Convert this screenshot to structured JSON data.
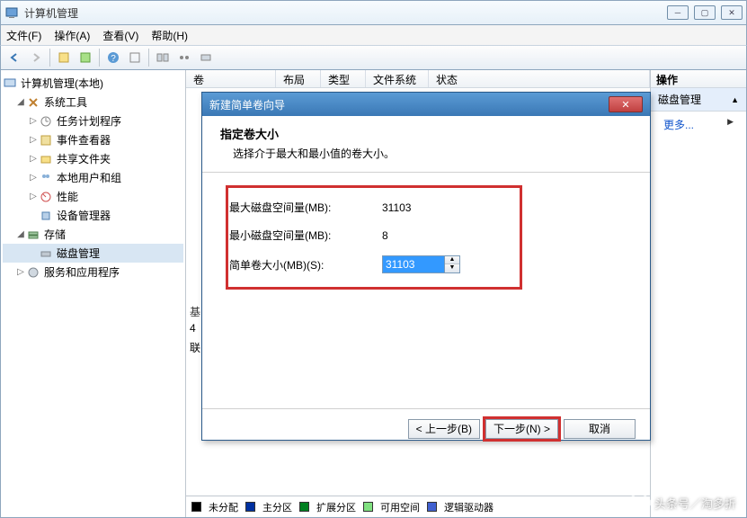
{
  "window": {
    "title": "计算机管理"
  },
  "menu": {
    "file": "文件(F)",
    "action": "操作(A)",
    "view": "查看(V)",
    "help": "帮助(H)"
  },
  "tree": {
    "root": "计算机管理(本地)",
    "system_tools": "系统工具",
    "task_scheduler": "任务计划程序",
    "event_viewer": "事件查看器",
    "shared_folders": "共享文件夹",
    "local_users": "本地用户和组",
    "performance": "性能",
    "device_manager": "设备管理器",
    "storage": "存储",
    "disk_management": "磁盘管理",
    "services_apps": "服务和应用程序"
  },
  "columns": {
    "volume": "卷",
    "layout": "布局",
    "type": "类型",
    "filesystem": "文件系统",
    "status": "状态"
  },
  "peek": {
    "l1": "基",
    "l2": "4",
    "l3": "联"
  },
  "right": {
    "header": "操作",
    "disk_mgmt": "磁盘管理",
    "more": "更多..."
  },
  "legend": {
    "unallocated": "未分配",
    "primary": "主分区",
    "extended": "扩展分区",
    "free": "可用空间",
    "logical": "逻辑驱动器"
  },
  "wizard": {
    "title": "新建简单卷向导",
    "heading": "指定卷大小",
    "subheading": "选择介于最大和最小值的卷大小。",
    "max_label": "最大磁盘空间量(MB):",
    "max_value": "31103",
    "min_label": "最小磁盘空间量(MB):",
    "min_value": "8",
    "size_label": "简单卷大小(MB)(S):",
    "size_value": "31103",
    "back": "< 上一步(B)",
    "next": "下一步(N) >",
    "cancel": "取消"
  },
  "watermark": {
    "text": "头条号／淘多折"
  }
}
